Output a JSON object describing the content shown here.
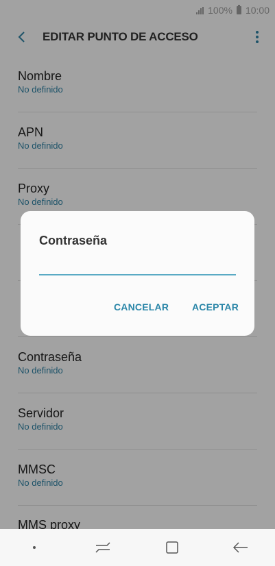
{
  "status_bar": {
    "battery": "100%",
    "time": "10:00"
  },
  "app_bar": {
    "title": "EDITAR PUNTO DE ACCESO"
  },
  "list": {
    "items": [
      {
        "title": "Nombre",
        "value": "No definido"
      },
      {
        "title": "APN",
        "value": "No definido"
      },
      {
        "title": "Proxy",
        "value": "No definido"
      },
      {
        "title": "",
        "value": ""
      },
      {
        "title": "",
        "value": ""
      },
      {
        "title": "Contraseña",
        "value": "No definido"
      },
      {
        "title": "Servidor",
        "value": "No definido"
      },
      {
        "title": "MMSC",
        "value": "No definido"
      }
    ],
    "partial_item_title": "MMS proxy"
  },
  "dialog": {
    "title": "Contraseña",
    "input_value": "",
    "cancel_label": "CANCELAR",
    "accept_label": "ACEPTAR"
  },
  "colors": {
    "accent": "#2a86a8",
    "subtitle": "#2e7fa0",
    "input_line": "#5aaac4"
  }
}
